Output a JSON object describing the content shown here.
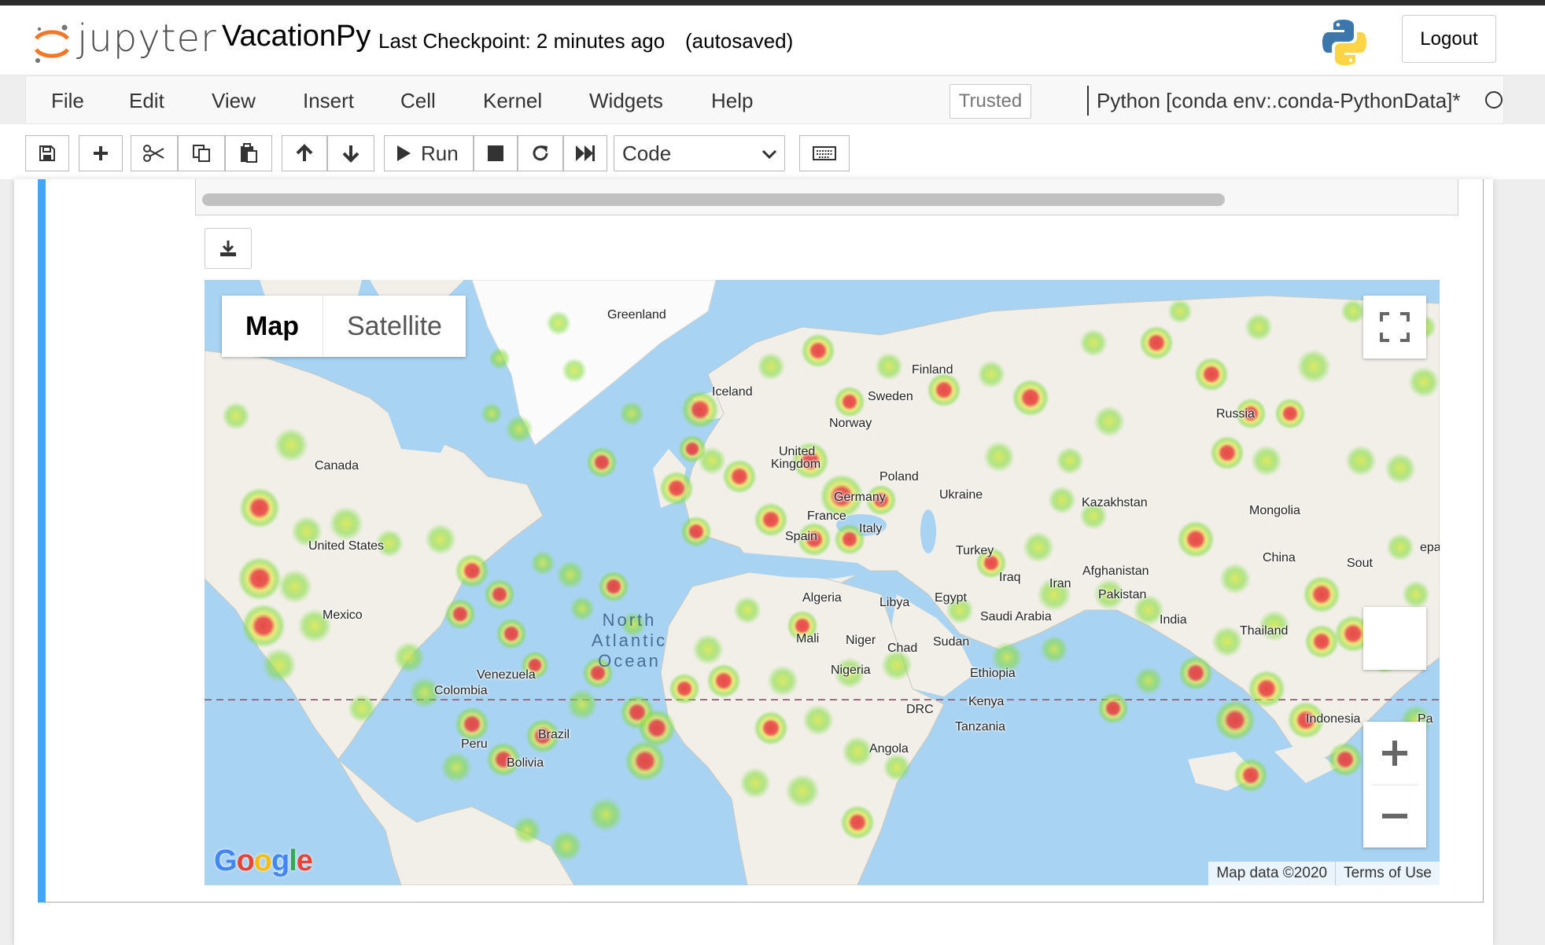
{
  "app": {
    "logo_text": "jupyter",
    "notebook_title": "VacationPy",
    "checkpoint": "Last Checkpoint: 2 minutes ago",
    "autosave": "(autosaved)",
    "logout": "Logout"
  },
  "menu": {
    "items": [
      "File",
      "Edit",
      "View",
      "Insert",
      "Cell",
      "Kernel",
      "Widgets",
      "Help"
    ],
    "trusted": "Trusted",
    "kernel": "Python [conda env:.conda-PythonData]*"
  },
  "toolbar": {
    "run_label": "Run",
    "cell_type": "Code"
  },
  "map": {
    "type_buttons": {
      "map": "Map",
      "satellite": "Satellite"
    },
    "ocean": [
      "North",
      "Atlantic",
      "Ocean"
    ],
    "labels": {
      "greenland": "Greenland",
      "iceland": "Iceland",
      "finland": "Finland",
      "sweden": "Sweden",
      "norway": "Norway",
      "russia": "Russia",
      "uk1": "United",
      "uk2": "Kingdom",
      "poland": "Poland",
      "germany": "Germany",
      "ukraine": "Ukraine",
      "kazakhstan": "Kazakhstan",
      "mongolia": "Mongolia",
      "france": "France",
      "italy": "Italy",
      "spain": "Spain",
      "turkey": "Turkey",
      "china": "China",
      "south": "Sout",
      "iraq": "Iraq",
      "iran": "Iran",
      "afghanistan": "Afghanistan",
      "pakistan": "Pakistan",
      "algeria": "Algeria",
      "libya": "Libya",
      "egypt": "Egypt",
      "saudi": "Saudi Arabia",
      "india": "India",
      "thailand": "Thailand",
      "mali": "Mali",
      "niger": "Niger",
      "chad": "Chad",
      "sudan": "Sudan",
      "nigeria": "Nigeria",
      "ethiopia": "Ethiopia",
      "kenya": "Kenya",
      "drc": "DRC",
      "tanzania": "Tanzania",
      "angola": "Angola",
      "indonesia": "Indonesia",
      "canada": "Canada",
      "us": "United States",
      "mexico": "Mexico",
      "venezuela": "Venezuela",
      "colombia": "Colombia",
      "brazil": "Brazil",
      "peru": "Peru",
      "bolivia": "Bolivia",
      "nepal_clip": "epa",
      "pa_clip": "Pa"
    },
    "attribution": {
      "data": "Map data ©2020",
      "terms": "Terms of Use"
    },
    "google": "Google",
    "colors": {
      "water": "#a9d3f2",
      "land": "#f1efe8",
      "heat_low": "#7fdb3a",
      "heat_mid": "#e8e84a",
      "heat_high": "#e8413c"
    }
  }
}
